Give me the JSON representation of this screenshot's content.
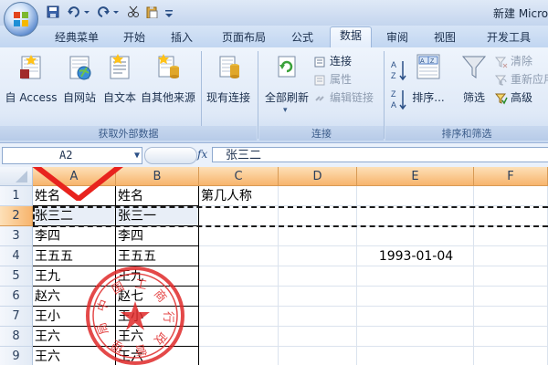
{
  "window": {
    "title": "新建 Micro"
  },
  "tabs": [
    "经典菜单",
    "开始",
    "插入",
    "页面布局",
    "公式",
    "数据",
    "审阅",
    "视图",
    "开发工具"
  ],
  "active_tab": "数据",
  "ribbon": {
    "get_external": {
      "label": "获取外部数据",
      "buttons": [
        "自 Access",
        "自网站",
        "自文本",
        "自其他来源",
        "现有连接"
      ]
    },
    "connections": {
      "label": "连接",
      "refresh": "全部刷新",
      "connections": "连接",
      "properties": "属性",
      "edit_links": "编辑链接"
    },
    "sort_filter": {
      "label": "排序和筛选",
      "sort": "排序...",
      "filter": "筛选",
      "clear": "清除",
      "reapply": "重新应用",
      "advanced": "高级"
    }
  },
  "formula_bar": {
    "name_box": "A2",
    "fx": "fx",
    "content": "张三二"
  },
  "columns": [
    "A",
    "B",
    "C",
    "D",
    "E",
    "F"
  ],
  "rows": [
    {
      "num": "1",
      "a": "姓名",
      "b": "姓名",
      "c": "第几人称",
      "e": ""
    },
    {
      "num": "2",
      "a": "张三二",
      "b": "张三一",
      "c": "",
      "e": ""
    },
    {
      "num": "3",
      "a": "李四",
      "b": "李四",
      "c": "",
      "e": ""
    },
    {
      "num": "4",
      "a": "王五五",
      "b": "王五五",
      "c": "",
      "e": "1993-01-04"
    },
    {
      "num": "5",
      "a": "王九",
      "b": "王九",
      "c": "",
      "e": ""
    },
    {
      "num": "6",
      "a": "赵六",
      "b": "赵七",
      "c": "",
      "e": ""
    },
    {
      "num": "7",
      "a": "王小",
      "b": "王小",
      "c": "",
      "e": ""
    },
    {
      "num": "8",
      "a": "王六",
      "b": "王六",
      "c": "",
      "e": ""
    },
    {
      "num": "9",
      "a": "王六",
      "b": "王六",
      "c": "",
      "e": ""
    }
  ],
  "stamp": {
    "text": "中国工商行政管理局"
  },
  "colors": {
    "arrow": "#e8231e",
    "stamp": "#e02a2a",
    "selected_header": "#f7b46c"
  }
}
